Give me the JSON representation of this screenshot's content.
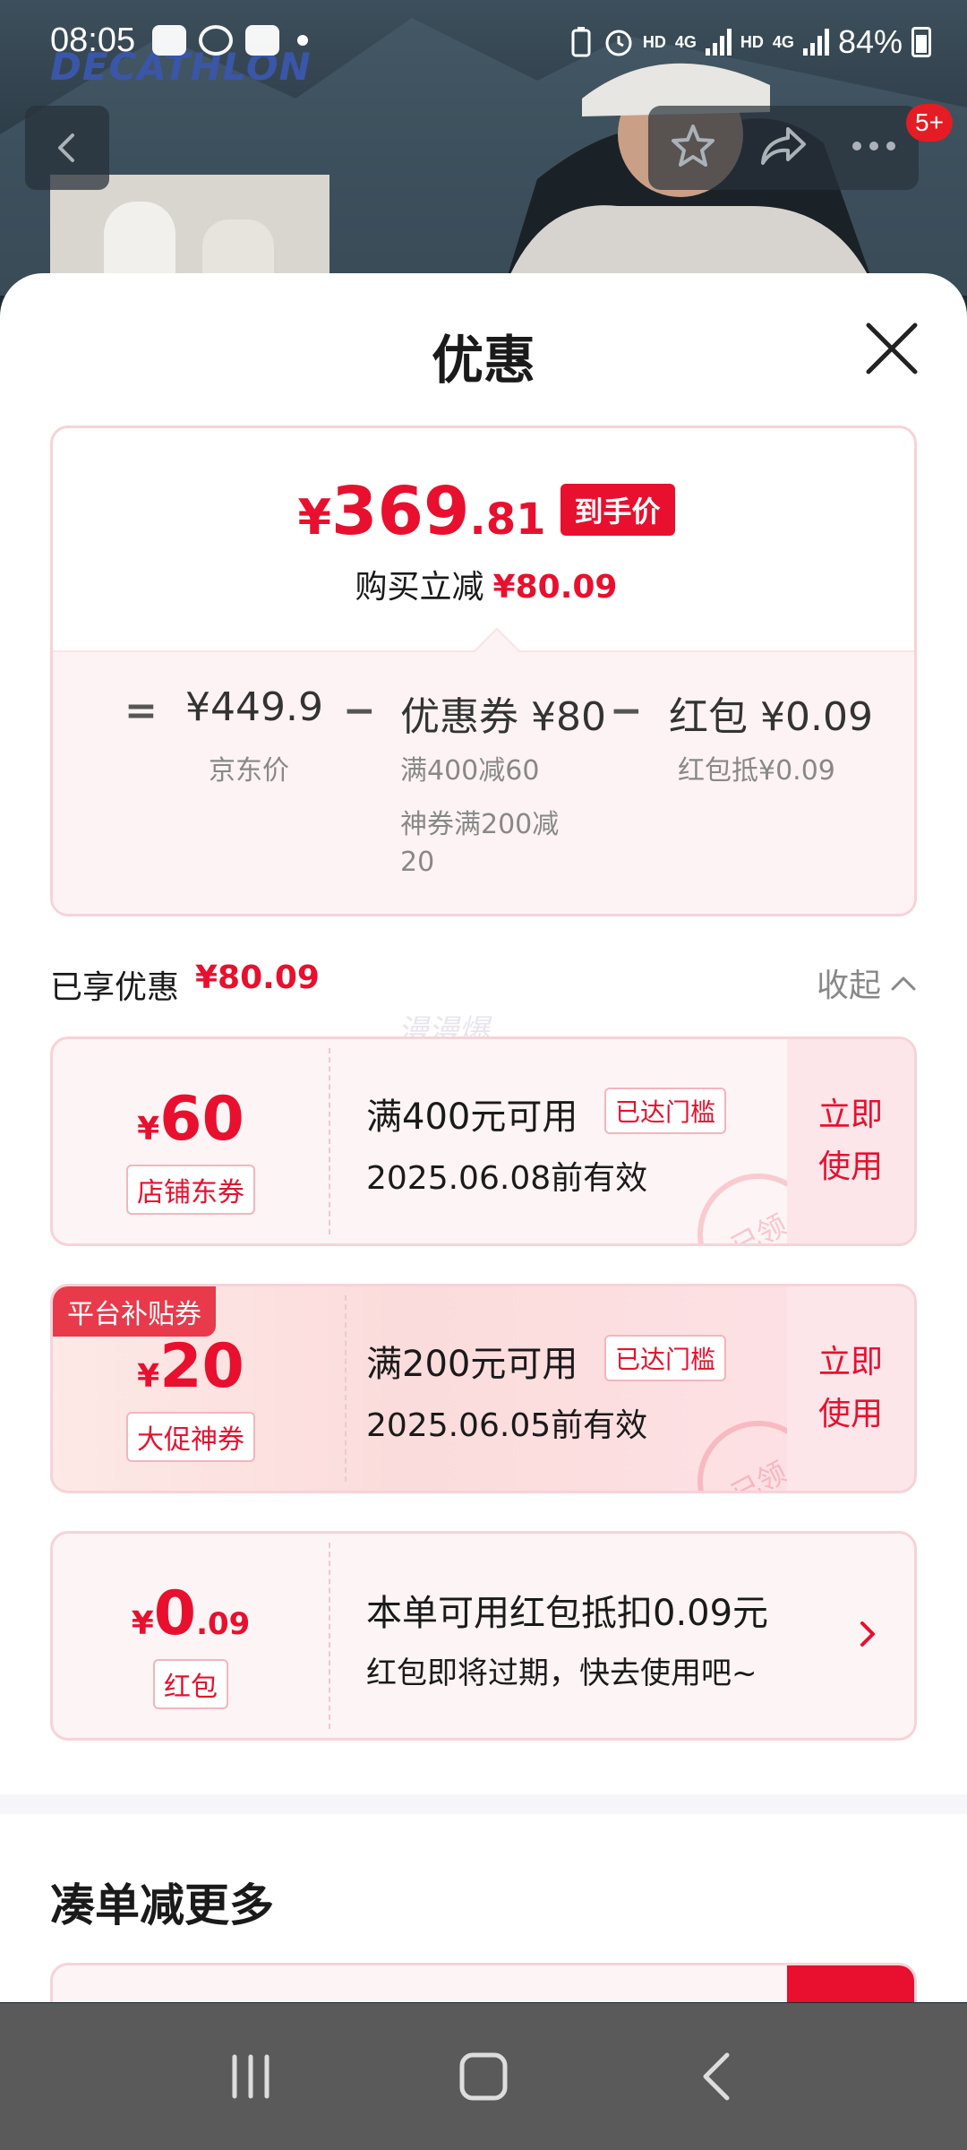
{
  "status_bar": {
    "time": "08:05",
    "battery": "84%",
    "net1": "HD",
    "net2": "4G",
    "net3": "HD",
    "net4": "4G"
  },
  "background_page": {
    "brand": "DECATHLON",
    "cart_badge": "5+"
  },
  "sheet": {
    "title": "优惠",
    "final_price": {
      "yen": "¥",
      "integer": "369",
      "decimal": ".81",
      "tag": "到手价"
    },
    "instant_discount": {
      "label": "购买立减",
      "value": "¥80.09"
    },
    "breakdown": {
      "eq": "=",
      "jd_price": "¥449.9",
      "jd_price_label": "京东价",
      "minus1": "−",
      "coupon": "优惠券 ¥80",
      "coupon_note1": "满400减60",
      "coupon_note2": "神券满200减20",
      "minus2": "−",
      "redpacket": "红包 ¥0.09",
      "redpacket_note": "红包抵¥0.09"
    },
    "enjoyed": {
      "label": "已享优惠",
      "value": "¥80.09",
      "collapse": "收起"
    },
    "watermark": "漫漫爆",
    "coupons": [
      {
        "yen": "¥",
        "amount": "60",
        "type": "店铺东券",
        "title": "满400元可用",
        "reached": "已达门槛",
        "date": "2025.06.08前有效",
        "use": "立即使用",
        "stamp": "已领"
      },
      {
        "flag": "平台补贴券",
        "yen": "¥",
        "amount": "20",
        "type": "大促神券",
        "title": "满200元可用",
        "reached": "已达门槛",
        "date": "2025.06.05前有效",
        "use": "立即使用",
        "stamp": "已领"
      },
      {
        "yen": "¥",
        "amount": "0",
        "decimal": ".09",
        "type": "红包",
        "title": "本单可用红包抵扣0.09元",
        "date": "红包即将过期，快去使用吧~"
      }
    ],
    "more_title": "凑单减更多"
  },
  "colors": {
    "accent": "#e8102e",
    "card_border": "#f6d3d8",
    "card_bg": "#fdf4f5"
  },
  "icons": {
    "back": "chevron-left-icon",
    "favorite": "star-icon",
    "share": "share-icon",
    "more": "ellipsis-icon",
    "close": "close-icon"
  }
}
